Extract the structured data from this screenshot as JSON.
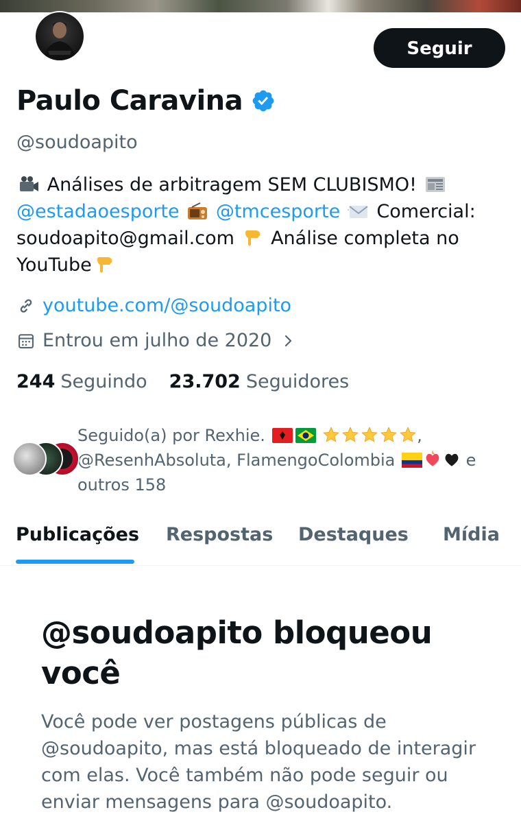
{
  "profile": {
    "name": "Paulo Caravina",
    "handle": "@soudoapito",
    "follow_label": "Seguir",
    "bio": {
      "line1_text": "Análises de arbitragem SEM CLUBISMO!",
      "mention1": "@estadaoesporte",
      "mention2": "@tmcesporte",
      "commercial": "Comercial:",
      "email": "soudoapito@gmail.com",
      "cta": "Análise completa no",
      "cta2": "YouTube"
    },
    "link": "youtube.com/@soudoapito",
    "joined": "Entrou em julho de 2020",
    "following_count": "244",
    "following_label": "Seguindo",
    "followers_count": "23.702",
    "followers_label": "Seguidores"
  },
  "followed_by": {
    "line1": "Seguido(a) por Rexhie.",
    "line2": "@ResenhAbsoluta, FlamengoColombia",
    "line2_end": "e",
    "line3": "outros 158"
  },
  "tabs": [
    {
      "label": "Publicações",
      "active": true
    },
    {
      "label": "Respostas",
      "active": false
    },
    {
      "label": "Destaques",
      "active": false
    },
    {
      "label": "Mídia",
      "active": false
    }
  ],
  "blocked": {
    "title": "@soudoapito bloqueou você",
    "description": "Você pode ver postagens públicas de @soudoapito, mas está bloqueado de interagir com elas. Você também não pode seguir ou enviar mensagens para @soudoapito."
  },
  "colors": {
    "accent": "#1d9bf0",
    "text": "#0f1419",
    "secondary": "#536471",
    "button": "#0f1419"
  },
  "icons": {
    "verified": "verified-badge-icon",
    "link": "link-icon",
    "calendar": "calendar-icon",
    "chevron": "chevron-right-icon"
  }
}
